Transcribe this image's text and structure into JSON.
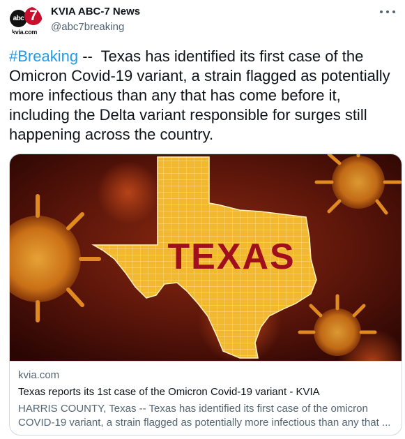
{
  "author": {
    "display_name": "KVIA ABC-7 News",
    "handle": "@abc7breaking",
    "avatar_text": {
      "abc": "abc",
      "seven": "7",
      "site": "kvia.com"
    }
  },
  "tweet": {
    "hashtag": "#Breaking",
    "body": " --  Texas has identified its first case of the Omicron Covid-19 variant, a strain flagged as potentially more infectious than any that has come before it, including the Delta variant responsible for surges still happening across the country."
  },
  "card": {
    "image_text": "TEXAS",
    "domain": "kvia.com",
    "title": "Texas reports its 1st case of the Omicron Covid-19 variant - KVIA",
    "description": "HARRIS COUNTY, Texas -- Texas has identified its first case of the omicron COVID-19 variant, a strain flagged as potentially more infectious than any that ..."
  },
  "colors": {
    "link": "#1d9bf0",
    "secondary_text": "#536471",
    "map_fill": "#f2b830",
    "map_text": "#a0101c",
    "background_dark": "#3a0a04"
  },
  "icons": [
    "more-options-icon",
    "virus-icon"
  ]
}
